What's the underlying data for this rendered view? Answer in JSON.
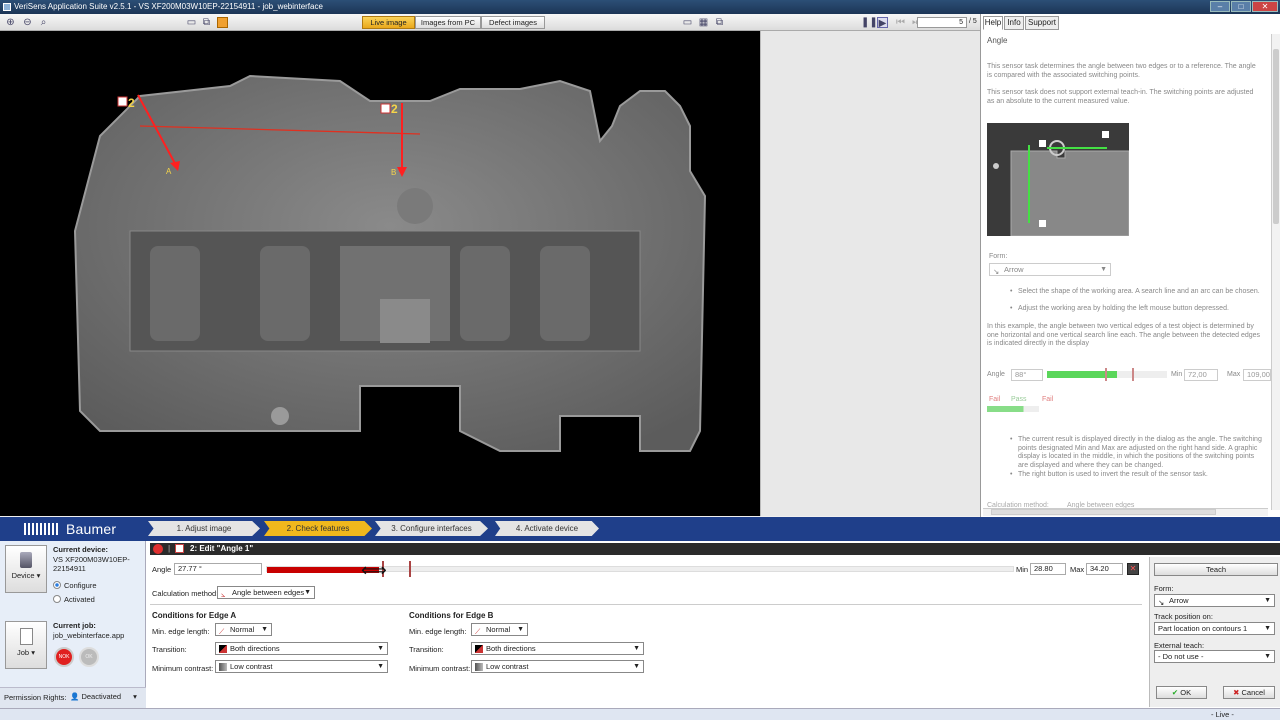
{
  "window": {
    "title": "VeriSens Application Suite v2.5.1 - VS XF200M03W10EP-22154911 - job_webinterface"
  },
  "toolbar": {
    "tab_live": "Live image",
    "tab_pc": "Images from PC",
    "tab_defect": "Defect images",
    "image_index": "5",
    "image_total": "/ 5"
  },
  "overlay": {
    "marker1": "2",
    "marker2": "2",
    "label_a": "A",
    "label_b": "B"
  },
  "help": {
    "tabs": [
      "Help",
      "Info",
      "Support"
    ],
    "title": "Angle",
    "p1": "This sensor task determines the angle between two edges or to a reference. The angle is compared with the associated switching points.",
    "p2": "This sensor task does not support external teach-in. The switching points are adjusted as an absolute to the current measured value.",
    "form_label": "Form:",
    "form_value": "Arrow",
    "b1": "Select the shape of the working area. A search line and an arc can be chosen.",
    "b2": "Adjust the working area by holding the left mouse button depressed.",
    "p3": "In this example, the angle between two vertical edges of a test object is determined by one horizontal and one vertical search line each. The angle between the detected edges is indicated directly in the display",
    "ex_angle_label": "Angle",
    "ex_angle_value": "88°",
    "ex_min_label": "Min",
    "ex_min_value": "72,00",
    "ex_max_label": "Max",
    "ex_max_value": "109,00",
    "fail1": "Fail",
    "pass": "Pass",
    "fail2": "Fail",
    "b3": "The current result is displayed directly in the dialog as the angle. The switching points designated Min and Max are adjusted on the right hand side. A graphic display is located in the middle, in which the positions of the switching points are displayed and where they can be changed.",
    "b4": "The right button is used to invert the result of the sensor task.",
    "cut_label": "Calculation method:",
    "cut_value": "Angle between edges"
  },
  "brand": "Baumer",
  "steps": [
    "1. Adjust image",
    "2. Check features",
    "3. Configure interfaces",
    "4. Activate device"
  ],
  "device": {
    "button": "Device",
    "heading": "Current device:",
    "name": "VS XF200M03W10EP-22154911",
    "configure": "Configure",
    "activated": "Activated"
  },
  "job": {
    "button": "Job",
    "heading": "Current job:",
    "name": "job_webinterface.app",
    "nok": "NOK",
    "ok": "OK"
  },
  "permission": {
    "label": "Permission Rights:",
    "value": "Deactivated"
  },
  "edit": {
    "title": "2: Edit \"Angle 1\"",
    "angle_label": "Angle",
    "angle_value": "27.77 °",
    "min_label": "Min",
    "min_value": "28.80",
    "max_label": "Max",
    "max_value": "34.20",
    "calc_label": "Calculation method:",
    "calc_value": "Angle between edges"
  },
  "edge_a": {
    "heading": "Conditions for Edge A",
    "len_label": "Min. edge length:",
    "len_value": "Normal",
    "trans_label": "Transition:",
    "trans_value": "Both directions",
    "contrast_label": "Minimum contrast:",
    "contrast_value": "Low contrast"
  },
  "edge_b": {
    "heading": "Conditions for Edge B",
    "len_label": "Min. edge length:",
    "len_value": "Normal",
    "trans_label": "Transition:",
    "trans_value": "Both directions",
    "contrast_label": "Minimum contrast:",
    "contrast_value": "Low contrast"
  },
  "right": {
    "teach": "Teach",
    "form_label": "Form:",
    "form_value": "Arrow",
    "track_label": "Track position on:",
    "track_value": "Part location on contours 1",
    "ext_label": "External teach:",
    "ext_value": "- Do not use -",
    "ok": "OK",
    "cancel": "Cancel"
  },
  "status": {
    "text": "- Live -"
  },
  "colors": {
    "accent": "#f0b81d",
    "brand": "#1f3f8a",
    "fail": "#c80000",
    "pass": "#5ad65a"
  }
}
